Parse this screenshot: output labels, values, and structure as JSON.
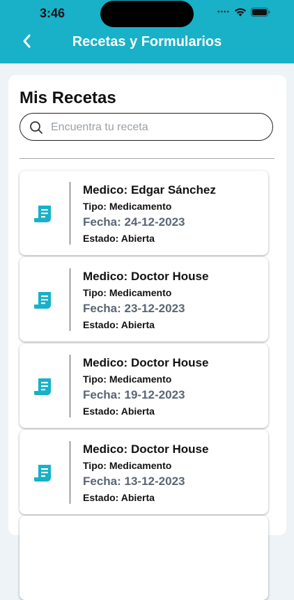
{
  "status_bar": {
    "time": "3:46"
  },
  "header": {
    "title": "Recetas y Formularios"
  },
  "main": {
    "title": "Mis Recetas",
    "search": {
      "placeholder": "Encuentra tu receta",
      "value": ""
    },
    "recetas": [
      {
        "medico": "Medico: Edgar Sánchez",
        "tipo": "Tipo: Medicamento",
        "fecha": "Fecha: 24-12-2023",
        "estado": "Estado: Abierta"
      },
      {
        "medico": "Medico: Doctor House",
        "tipo": "Tipo: Medicamento",
        "fecha": "Fecha: 23-12-2023",
        "estado": "Estado: Abierta"
      },
      {
        "medico": "Medico: Doctor House",
        "tipo": "Tipo: Medicamento",
        "fecha": "Fecha: 19-12-2023",
        "estado": "Estado: Abierta"
      },
      {
        "medico": "Medico: Doctor House",
        "tipo": "Tipo: Medicamento",
        "fecha": "Fecha: 13-12-2023",
        "estado": "Estado: Abierta"
      }
    ]
  },
  "colors": {
    "accent": "#18b1c7",
    "background": "#edf3f6",
    "date_text": "#5a6675"
  },
  "icons": [
    "back-arrow-icon",
    "search-icon",
    "receipt-icon",
    "wifi-icon",
    "battery-icon"
  ]
}
